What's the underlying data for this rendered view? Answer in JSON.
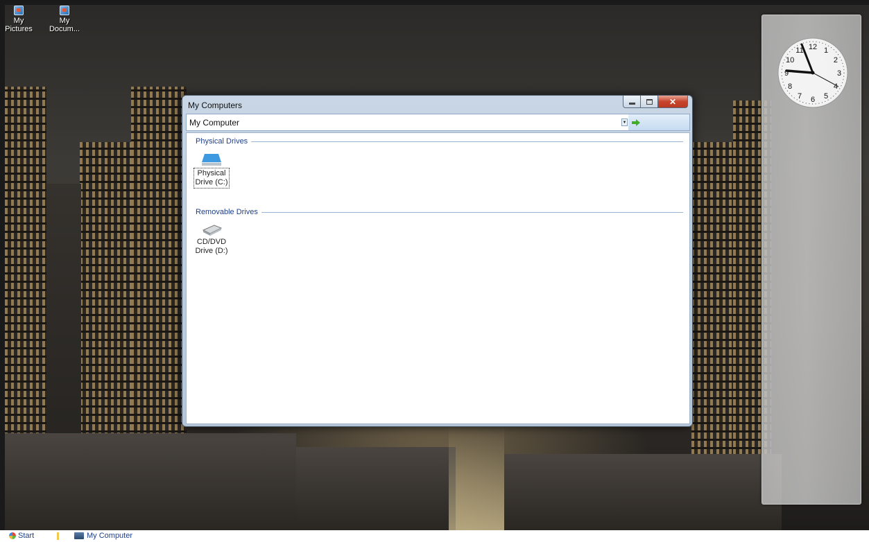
{
  "desktop": {
    "icons": [
      {
        "label_line1": "My",
        "label_line2": "Pictures"
      },
      {
        "label_line1": "My",
        "label_line2": "Docum..."
      }
    ]
  },
  "window": {
    "title": "My Computers",
    "address": "My Computer",
    "groups": [
      {
        "header": "Physical Drives",
        "items": [
          {
            "line1": "Physical",
            "line2": "Drive (C:)",
            "icon": "hard-drive-icon"
          }
        ]
      },
      {
        "header": "Removable Drives",
        "items": [
          {
            "line1": "CD/DVD",
            "line2": "Drive (D:)",
            "icon": "optical-drive-icon"
          }
        ]
      }
    ],
    "caption_icons": [
      "minimize-icon",
      "maximize-icon",
      "close-icon"
    ]
  },
  "clock": {
    "numerals": [
      "12",
      "1",
      "2",
      "3",
      "4",
      "5",
      "6",
      "7",
      "8",
      "9",
      "10",
      "11"
    ],
    "time": "9:20"
  },
  "taskbar": {
    "start_label": "Start",
    "task_label": "My Computer"
  }
}
